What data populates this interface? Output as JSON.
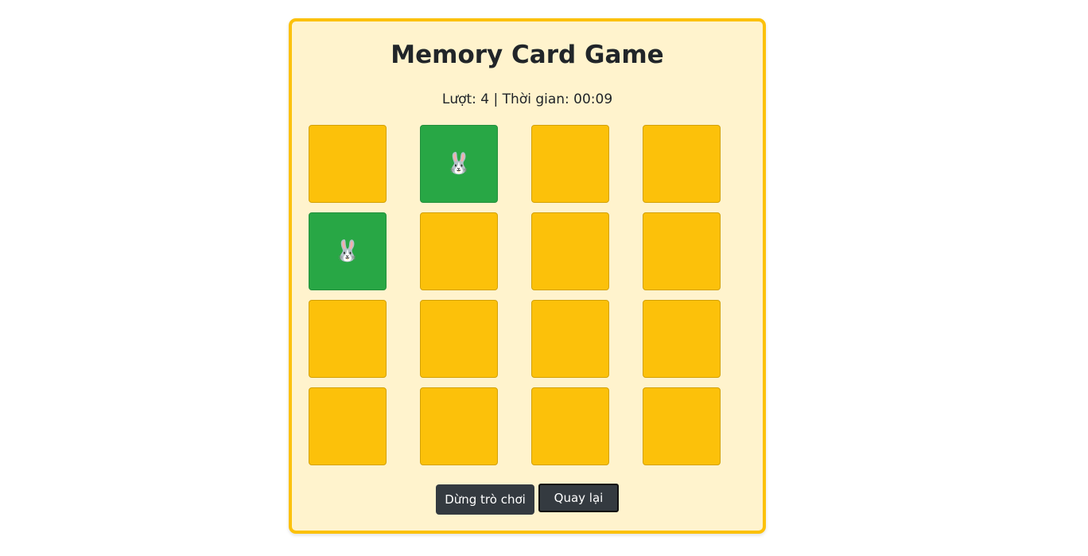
{
  "game": {
    "title": "Memory Card Game",
    "status_text": "Lượt: 4 | Thời gian: 00:09",
    "colors": {
      "card_back": "#fcc10a",
      "card_matched": "#28a745",
      "panel_bg": "#fff3cd",
      "panel_border": "#fcc10a",
      "button_bg": "#343a40"
    },
    "cards": [
      {
        "state": "hidden",
        "face": ""
      },
      {
        "state": "matched",
        "face": "🐰"
      },
      {
        "state": "hidden",
        "face": ""
      },
      {
        "state": "hidden",
        "face": ""
      },
      {
        "state": "matched",
        "face": "🐰"
      },
      {
        "state": "hidden",
        "face": ""
      },
      {
        "state": "hidden",
        "face": ""
      },
      {
        "state": "hidden",
        "face": ""
      },
      {
        "state": "hidden",
        "face": ""
      },
      {
        "state": "hidden",
        "face": ""
      },
      {
        "state": "hidden",
        "face": ""
      },
      {
        "state": "hidden",
        "face": ""
      },
      {
        "state": "hidden",
        "face": ""
      },
      {
        "state": "hidden",
        "face": ""
      },
      {
        "state": "hidden",
        "face": ""
      },
      {
        "state": "hidden",
        "face": ""
      }
    ],
    "stop_button_label": "Dừng trò chơi",
    "back_button_label": "Quay lại"
  }
}
